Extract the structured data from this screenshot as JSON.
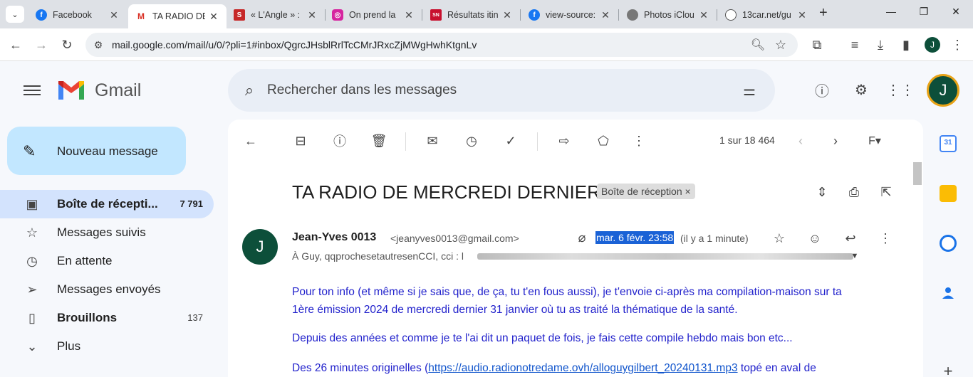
{
  "browser": {
    "tabs": [
      {
        "title": "Facebook",
        "active": false
      },
      {
        "title": "TA RADIO DE",
        "active": true
      },
      {
        "title": "« L'Angle » :",
        "active": false
      },
      {
        "title": "On prend la",
        "active": false
      },
      {
        "title": "Résultats itin",
        "active": false
      },
      {
        "title": "view-source:",
        "active": false
      },
      {
        "title": "Photos iClou",
        "active": false
      },
      {
        "title": "13car.net/gu",
        "active": false
      }
    ],
    "url": "mail.google.com/mail/u/0/?pli=1#inbox/QgrcJHsblRrlTcCMrJRxcZjMWgHwhKtgnLv",
    "profile_initial": "J"
  },
  "gmail": {
    "logo_text": "Gmail",
    "search_placeholder": "Rechercher dans les messages",
    "avatar_initial": "J",
    "compose_label": "Nouveau message",
    "nav": [
      {
        "label": "Boîte de récepti...",
        "count": "7 791",
        "active": true,
        "bold": true,
        "icon": "inbox-icon"
      },
      {
        "label": "Messages suivis",
        "count": "",
        "active": false,
        "bold": false,
        "icon": "star-icon"
      },
      {
        "label": "En attente",
        "count": "",
        "active": false,
        "bold": false,
        "icon": "clock-icon"
      },
      {
        "label": "Messages envoyés",
        "count": "",
        "active": false,
        "bold": false,
        "icon": "send-icon"
      },
      {
        "label": "Brouillons",
        "count": "137",
        "active": false,
        "bold": true,
        "icon": "draft-icon"
      },
      {
        "label": "Plus",
        "count": "",
        "active": false,
        "bold": false,
        "icon": "chevron-down-icon"
      }
    ],
    "pager": "1 sur 18 464",
    "message": {
      "subject": "TA RADIO DE MERCREDI DERNIER",
      "label_chip": "Boîte de réception",
      "sender_name": "Jean-Yves 0013",
      "sender_email": "<jeanyves0013@gmail.com>",
      "sender_initial": "J",
      "date": "mar. 6 févr. 23:58",
      "date_relative": "(il y a 1 minute)",
      "recipients": "À Guy, qqprochesetautresenCCI, cci : l",
      "body": {
        "p1": "Pour ton info (et même si je sais que, de ça, tu t'en fous aussi), je t'envoie ci-après ma compilation-maison sur ta 1ère émission 2024 de mercredi dernier 31 janvier où tu as traité la thématique de la santé.",
        "p2": "Depuis des années et comme je te l'ai dit un paquet de fois, je fais cette compile hebdo mais bon etc...",
        "p3_prefix": "Des 26 minutes originelles (",
        "p3_link": "https://audio.radionotredame.ovh/alloguygilbert_20240131.mp3",
        "p3_suffix": " topé en aval de"
      }
    }
  },
  "colors": {
    "compose_bg": "#c2e7ff",
    "active_nav_bg": "#d3e3fd",
    "selection_bg": "#1a62d6",
    "body_text": "#2222cc",
    "avatar_bg": "#0d4f3a"
  }
}
